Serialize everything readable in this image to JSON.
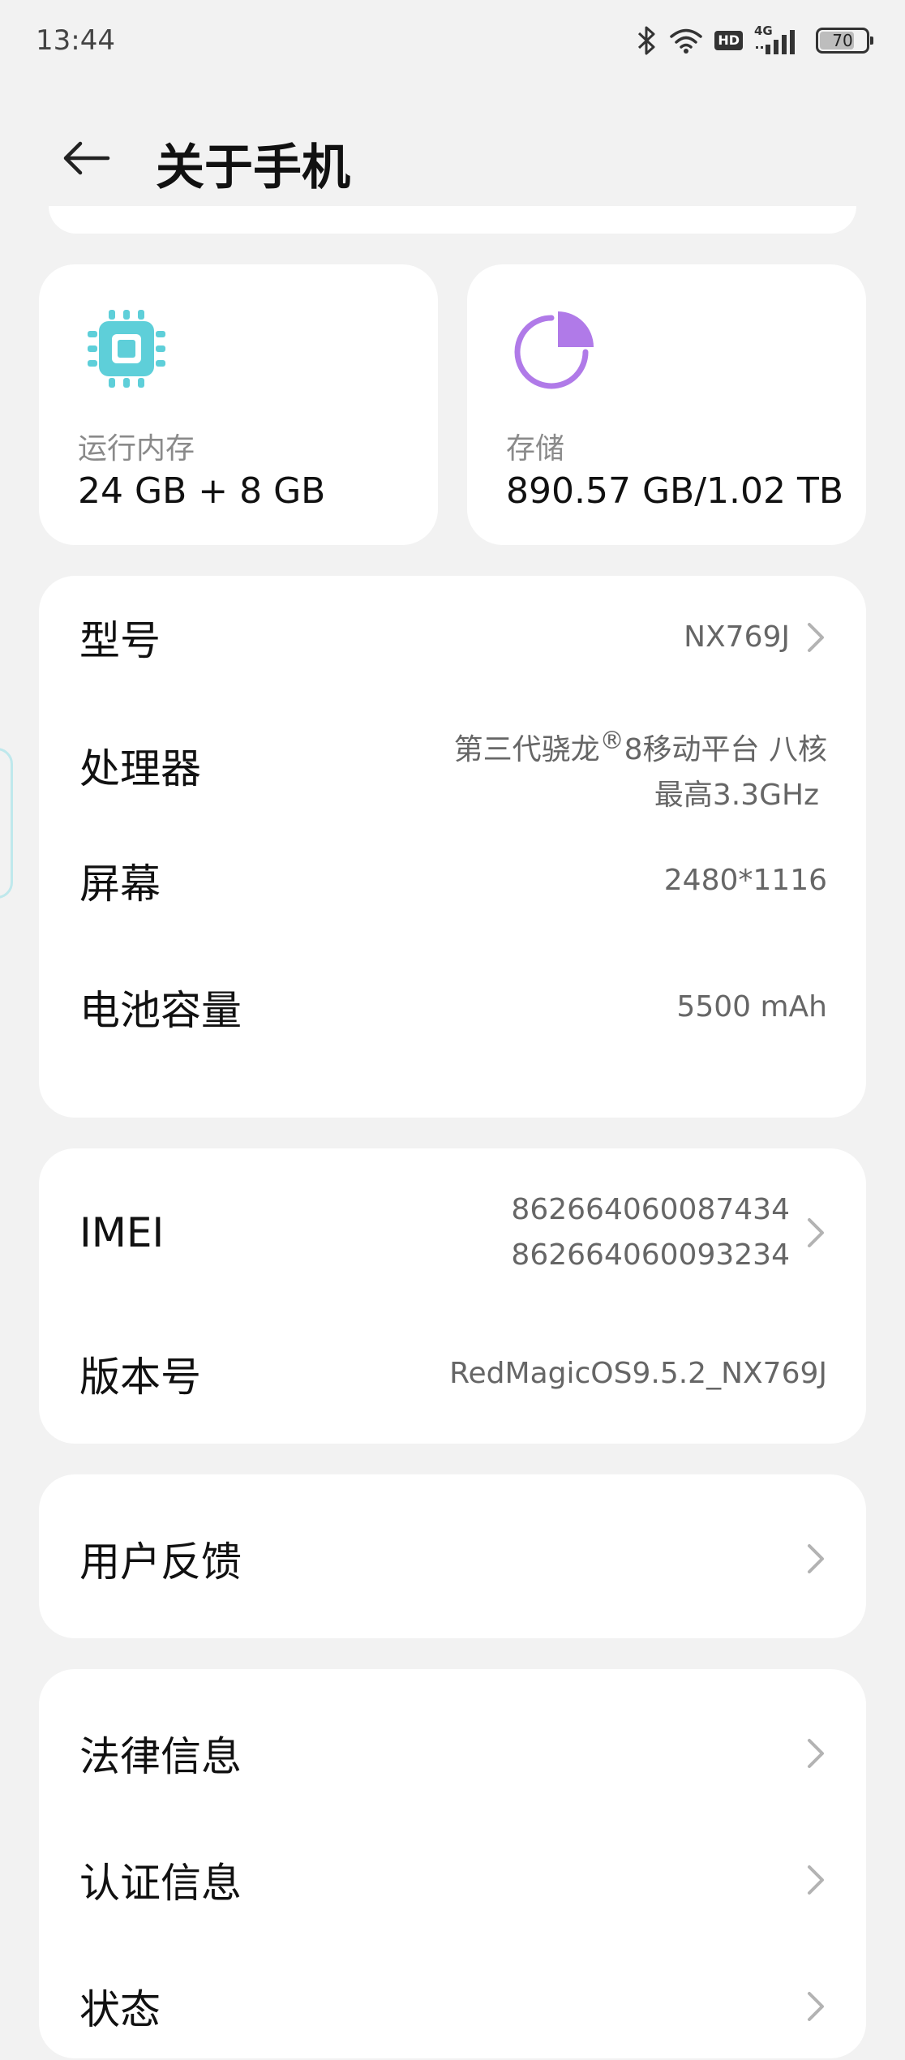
{
  "status_bar": {
    "time": "13:44",
    "icons": [
      "bluetooth-icon",
      "wifi-icon",
      "hd-icon",
      "cellular-4g-icon",
      "battery-icon"
    ],
    "hd_label": "HD",
    "network_label": "4G",
    "battery_level": "70"
  },
  "header": {
    "title": "关于手机"
  },
  "spec_cards": {
    "ram": {
      "label": "运行内存",
      "value": "24 GB + 8 GB",
      "icon": "chip-icon",
      "icon_color": "#5ecfd9"
    },
    "storage": {
      "label": "存储",
      "value": "890.57 GB/1.02 TB",
      "icon": "pie-chart-icon",
      "icon_color": "#b07ae8"
    }
  },
  "device_info": {
    "model": {
      "label": "型号",
      "value": "NX769J"
    },
    "processor": {
      "label": "处理器",
      "line1_a": "第三代骁龙",
      "registered": "®",
      "line1_b": "8移动平台 八核",
      "line2": "最高3.3GHz"
    },
    "screen": {
      "label": "屏幕",
      "value": "2480*1116"
    },
    "battery": {
      "label": "电池容量",
      "value": "5500 mAh"
    }
  },
  "identity": {
    "imei": {
      "label": "IMEI",
      "value1": "862664060087434",
      "value2": "862664060093234"
    },
    "build": {
      "label": "版本号",
      "value": "RedMagicOS9.5.2_NX769J"
    }
  },
  "feedback": {
    "label": "用户反馈"
  },
  "legal": {
    "legal_info": {
      "label": "法律信息"
    },
    "certification": {
      "label": "认证信息"
    },
    "status": {
      "label": "状态"
    }
  },
  "colors": {
    "background": "#f2f2f2",
    "card": "#ffffff",
    "chip_accent": "#5ecfd9",
    "storage_accent": "#b07ae8"
  }
}
